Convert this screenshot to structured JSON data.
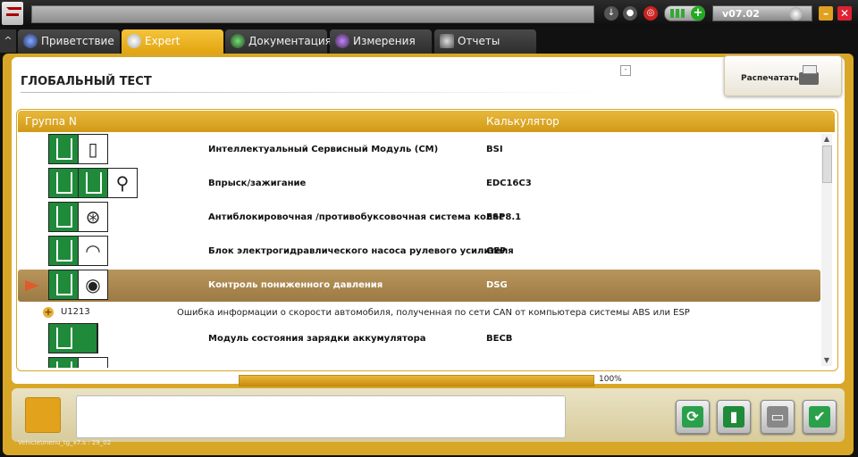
{
  "topbar": {
    "version": "v07.02"
  },
  "tabs": [
    {
      "label": "Приветствие",
      "active": false
    },
    {
      "label": "Expert",
      "active": true
    },
    {
      "label": "Документация",
      "active": false
    },
    {
      "label": "Измерения",
      "active": false
    },
    {
      "label": "Отчеты",
      "active": false
    }
  ],
  "panel": {
    "title": "ГЛОБАЛЬНЫЙ ТЕСТ",
    "print_label": "Распечатать"
  },
  "table": {
    "headers": [
      "Группа N",
      "Калькулятор"
    ],
    "rows": [
      {
        "name": "Интеллектуальный Сервисный Модуль (СМ)",
        "calc": "BSI"
      },
      {
        "name": "Впрыск/зажигание",
        "calc": "EDC16C3"
      },
      {
        "name": "Антиблокировочная /противобуксовочная система колес",
        "calc": "ESP8.1"
      },
      {
        "name": "Блок электрогидравлического насоса рулевого усилителя",
        "calc": "GEP"
      },
      {
        "name": "Контроль пониженного давления",
        "calc": "DSG"
      },
      {
        "name": "Модуль состояния зарядки аккумулятора",
        "calc": "BECB"
      }
    ],
    "fault": {
      "code": "U1213",
      "text": "Ошибка информации о скорости автомобиля, полученная по сети CAN от компьютера системы ABS или ESP"
    }
  },
  "progress": {
    "value": 1.0,
    "label": "100%"
  },
  "footer": {
    "path": "Vehicle\\menu_tg_x7.s : 29_02"
  },
  "colors": {
    "accent": "#d9a727",
    "selected_row": "#a6834a",
    "icon_green": "#1e8a3a"
  }
}
